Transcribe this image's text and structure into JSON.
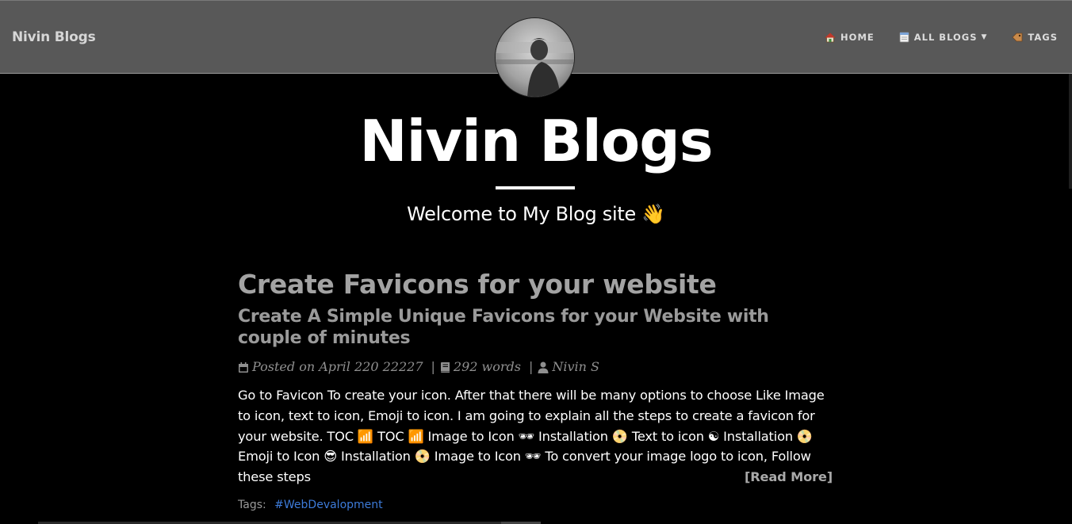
{
  "navbar": {
    "brand": "Nivin Blogs",
    "links": [
      {
        "label": "HOME",
        "icon": "house-icon"
      },
      {
        "label": "ALL BLOGS",
        "icon": "notebook-icon",
        "caret": "▼"
      },
      {
        "label": "TAGS",
        "icon": "tag-icon"
      }
    ]
  },
  "avatar": {
    "icon": "profile-photo"
  },
  "hero": {
    "title": "Nivin Blogs",
    "subtitle": "Welcome to My Blog site 👋"
  },
  "post": {
    "title": "Create Favicons for your website",
    "subtitle": "Create A Simple Unique Favicons for your Website with couple of minutes",
    "meta": {
      "date": "Posted on April 220 22227",
      "words": "292 words",
      "author": "Nivin S"
    },
    "excerpt": "Go to Favicon To create your icon. After that there will be many options to choose Like Image to icon, text to icon, Emoji to icon. I am going to explain all the steps to create a favicon for your website. TOC 📶 TOC 📶 Image to Icon 🕶 Installation 📀 Text to icon ☯ Installation 📀 Emoji to Icon 😎 Installation 📀 Image to Icon 🕶 To convert your image logo to icon, Follow these steps",
    "read_more": "[Read More]",
    "tags_label": "Tags:",
    "tags": [
      "#WebDevalopment"
    ]
  },
  "colors": {
    "navbar_bg": "#585858",
    "page_bg": "#000000",
    "post_title": "#a3a3a3",
    "tag_link": "#3d7bd9"
  }
}
